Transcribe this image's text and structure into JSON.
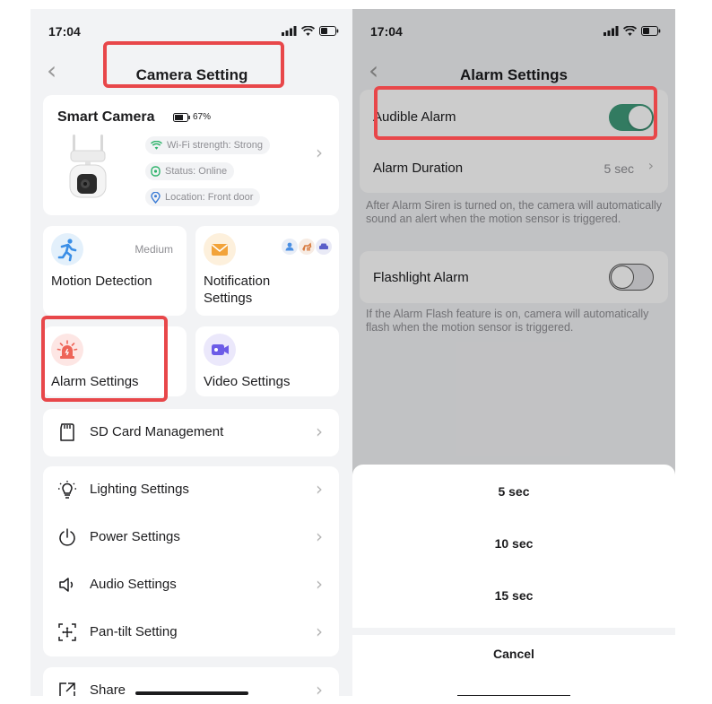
{
  "status_bar": {
    "time": "17:04"
  },
  "left": {
    "nav": {
      "title": "Camera Setting"
    },
    "device": {
      "name": "Smart Camera",
      "battery": "67%",
      "wifi": "Wi-Fi strength: Strong",
      "status": "Status: Online",
      "location": "Location: Front door"
    },
    "tiles": {
      "motion": {
        "label": "Motion Detection",
        "level": "Medium"
      },
      "notification": {
        "label1": "Notification",
        "label2": "Settings"
      },
      "alarm": {
        "label": "Alarm Settings"
      },
      "video": {
        "label": "Video Settings"
      }
    },
    "sd_card": {
      "label": "SD Card Management"
    },
    "list": [
      {
        "label": "Lighting Settings",
        "icon": "bulb-icon"
      },
      {
        "label": "Power Settings",
        "icon": "power-icon"
      },
      {
        "label": "Audio Settings",
        "icon": "speaker-icon"
      },
      {
        "label": "Pan-tilt Setting",
        "icon": "move-icon"
      }
    ],
    "share": {
      "label": "Share"
    }
  },
  "right": {
    "nav": {
      "title": "Alarm Settings"
    },
    "audible": {
      "label": "Audible Alarm",
      "enabled": true
    },
    "duration": {
      "label": "Alarm Duration",
      "value": "5 sec"
    },
    "audible_desc": "After Alarm Siren is turned on, the camera will automatically sound an alert when the motion sensor is triggered.",
    "flashlight": {
      "label": "Flashlight Alarm",
      "enabled": false
    },
    "flash_desc": "If the Alarm Flash feature is on, camera will automatically flash when the motion sensor is triggered.",
    "sheet": {
      "options": [
        "5 sec",
        "10 sec",
        "15 sec"
      ],
      "cancel": "Cancel"
    }
  },
  "colors": {
    "toggle_on": "#3f9a7a",
    "highlight": "#e8474a",
    "accent_blue": "#3a7bd5"
  }
}
